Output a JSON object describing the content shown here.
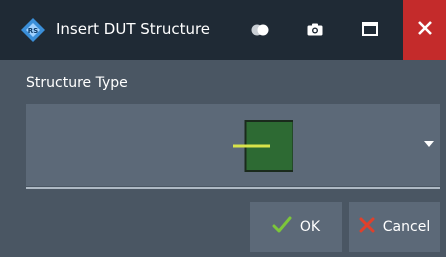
{
  "window": {
    "title": "Insert DUT Structure",
    "app_icon": "rohde-schwarz-diamond-icon",
    "controls": {
      "toggle_icon": "toggle-icon",
      "camera_icon": "camera-icon",
      "maximize_icon": "maximize-icon",
      "close_icon": "close-icon"
    }
  },
  "form": {
    "structure_type_label": "Structure Type",
    "structure_type_selected_icon": "dut-structure-preview-icon"
  },
  "buttons": {
    "ok_label": "OK",
    "cancel_label": "Cancel"
  },
  "colors": {
    "titlebar": "#1f2a35",
    "dialog_background": "#4a5663",
    "control_background": "#5c6978",
    "close_red": "#c42b2b",
    "ok_green": "#7cc63a",
    "cancel_red": "#e0402b",
    "preview_fill": "#2d6a33",
    "preview_line": "#d8e34a"
  }
}
